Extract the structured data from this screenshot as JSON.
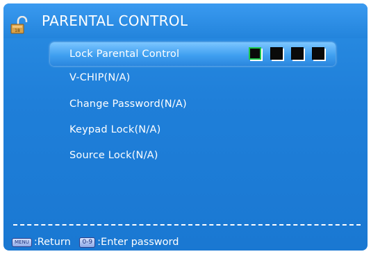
{
  "header": {
    "title": "PARENTAL CONTROL",
    "icon": "padlock-icon"
  },
  "menu": {
    "selected": "Lock Parental Control",
    "items": [
      {
        "label": "Lock Parental Control",
        "selected": true
      },
      {
        "label": "V-CHIP(N/A)"
      },
      {
        "label": "Change Password(N/A)"
      },
      {
        "label": "Keypad Lock(N/A)"
      },
      {
        "label": "Source Lock(N/A)"
      }
    ]
  },
  "pin": {
    "length": 4,
    "active_index": 0
  },
  "footer": {
    "menu_key": "MENU",
    "menu_action": ":Return",
    "num_key": "0-9",
    "num_action": ":Enter password"
  },
  "colors": {
    "background": "#1f7fd9",
    "highlight": "#5ab3ff",
    "active_box": "#1cc74b",
    "text": "#ffffff"
  }
}
